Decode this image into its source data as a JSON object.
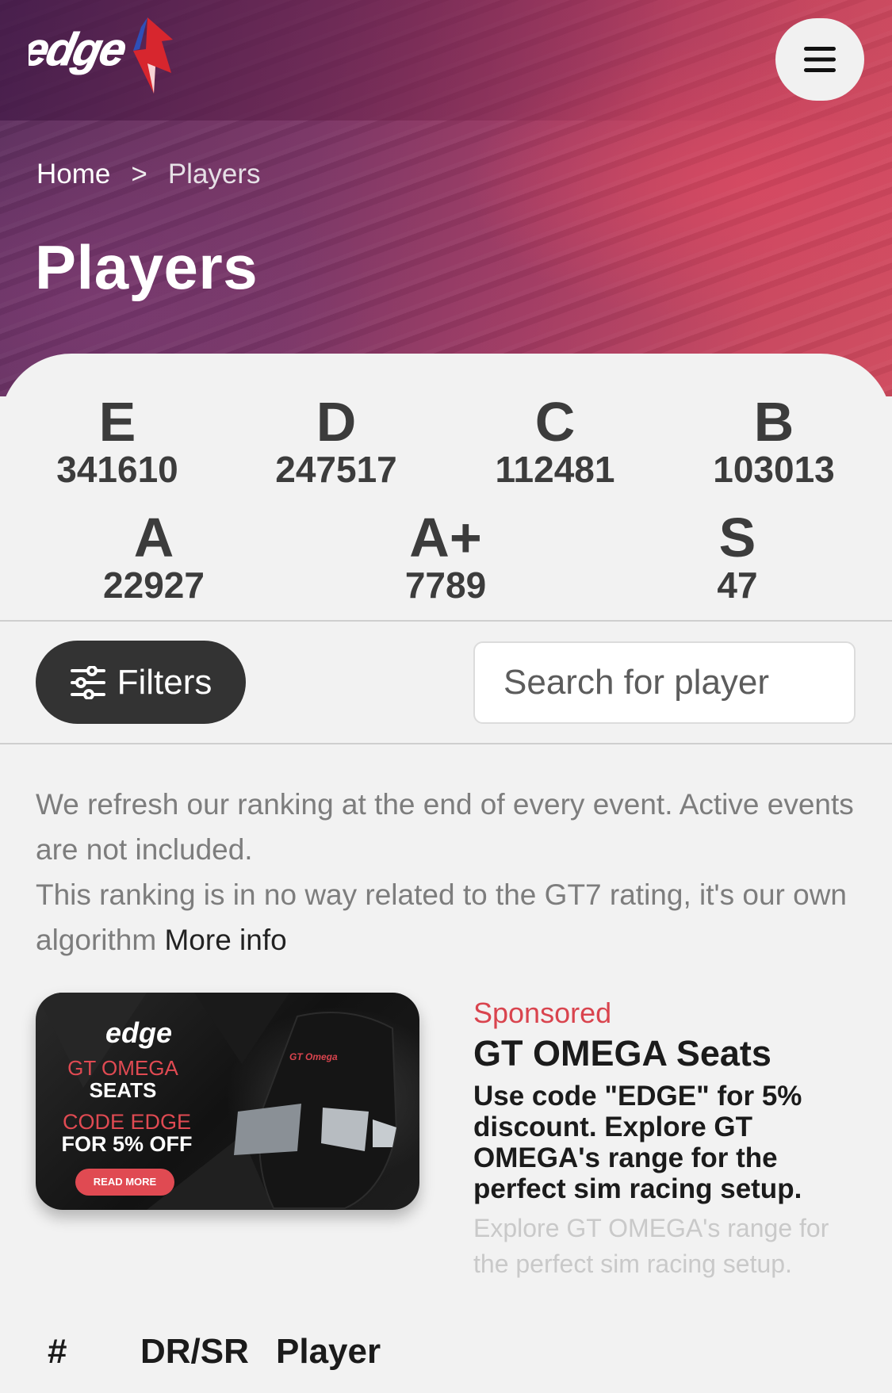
{
  "header": {
    "logo_text": "edge",
    "menu_icon": "hamburger-icon"
  },
  "breadcrumb": {
    "home": "Home",
    "separator": ">",
    "current": "Players"
  },
  "page_title": "Players",
  "ratings": [
    {
      "letter": "E",
      "count": "341610"
    },
    {
      "letter": "D",
      "count": "247517"
    },
    {
      "letter": "C",
      "count": "112481"
    },
    {
      "letter": "B",
      "count": "103013"
    },
    {
      "letter": "A",
      "count": "22927"
    },
    {
      "letter": "A+",
      "count": "7789"
    },
    {
      "letter": "S",
      "count": "47"
    }
  ],
  "filters": {
    "label": "Filters",
    "icon": "sliders-icon"
  },
  "search": {
    "placeholder": "Search for player",
    "value": ""
  },
  "info": {
    "line1": "We refresh our ranking at the end of every event. Active events are not included.",
    "line2": "This ranking is in no way related to the GT7 rating, it's our own algorithm",
    "more_info": "More info"
  },
  "sponsored": {
    "label": "Sponsored",
    "title": "GT OMEGA Seats",
    "description": "Use code \"EDGE\" for 5% discount. Explore GT OMEGA's range for the perfect sim racing setup.",
    "subtext": "Explore GT OMEGA's range for the perfect sim racing setup.",
    "banner": {
      "brand": "edge",
      "line1": "GT OMEGA",
      "line2": "SEATS",
      "line3": "CODE EDGE",
      "line4": "FOR 5% OFF",
      "button": "READ MORE",
      "seat_brand": "GT Omega"
    }
  },
  "table": {
    "columns": [
      "#",
      "DR/SR",
      "Player"
    ]
  },
  "colors": {
    "accent_red": "#d9444e",
    "dark_button": "#333333",
    "hero_start": "#5d2f5f",
    "hero_end": "#cf4a5e"
  }
}
